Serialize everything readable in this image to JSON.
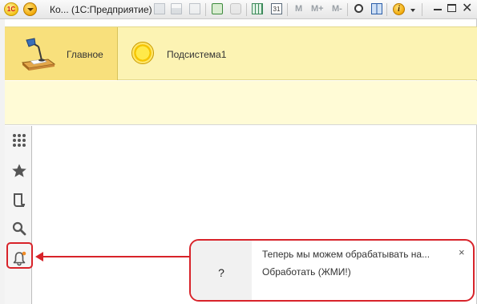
{
  "app": {
    "logo_text": "1С",
    "window_title_prefix": "Ко...",
    "window_title_app": "(1С:Предприятие)",
    "calendar_day": "31",
    "m_label": "M",
    "m_plus_label": "M+",
    "m_minus_label": "M-"
  },
  "sections": {
    "items": [
      {
        "label": "Главное",
        "icon": "desk-lamp-icon",
        "active": true
      },
      {
        "label": "Подсистема1",
        "icon": "yellow-circle-icon",
        "active": false
      }
    ]
  },
  "sidebar": {
    "items": [
      {
        "name": "all-functions",
        "icon": "grid-icon"
      },
      {
        "name": "favorites",
        "icon": "star-icon"
      },
      {
        "name": "history",
        "icon": "history-icon"
      },
      {
        "name": "search",
        "icon": "search-icon"
      },
      {
        "name": "notifications",
        "icon": "bell-icon",
        "has_badge": true
      }
    ]
  },
  "notification": {
    "icon_text": "?",
    "text": "Теперь мы можем обрабатывать на...",
    "link": "Обработать (ЖМИ!)",
    "close": "×"
  },
  "colors": {
    "highlight": "#d8232a",
    "section_active": "#f8e07c",
    "section_bg": "#fcf3b3",
    "badge": "#f08a24"
  }
}
